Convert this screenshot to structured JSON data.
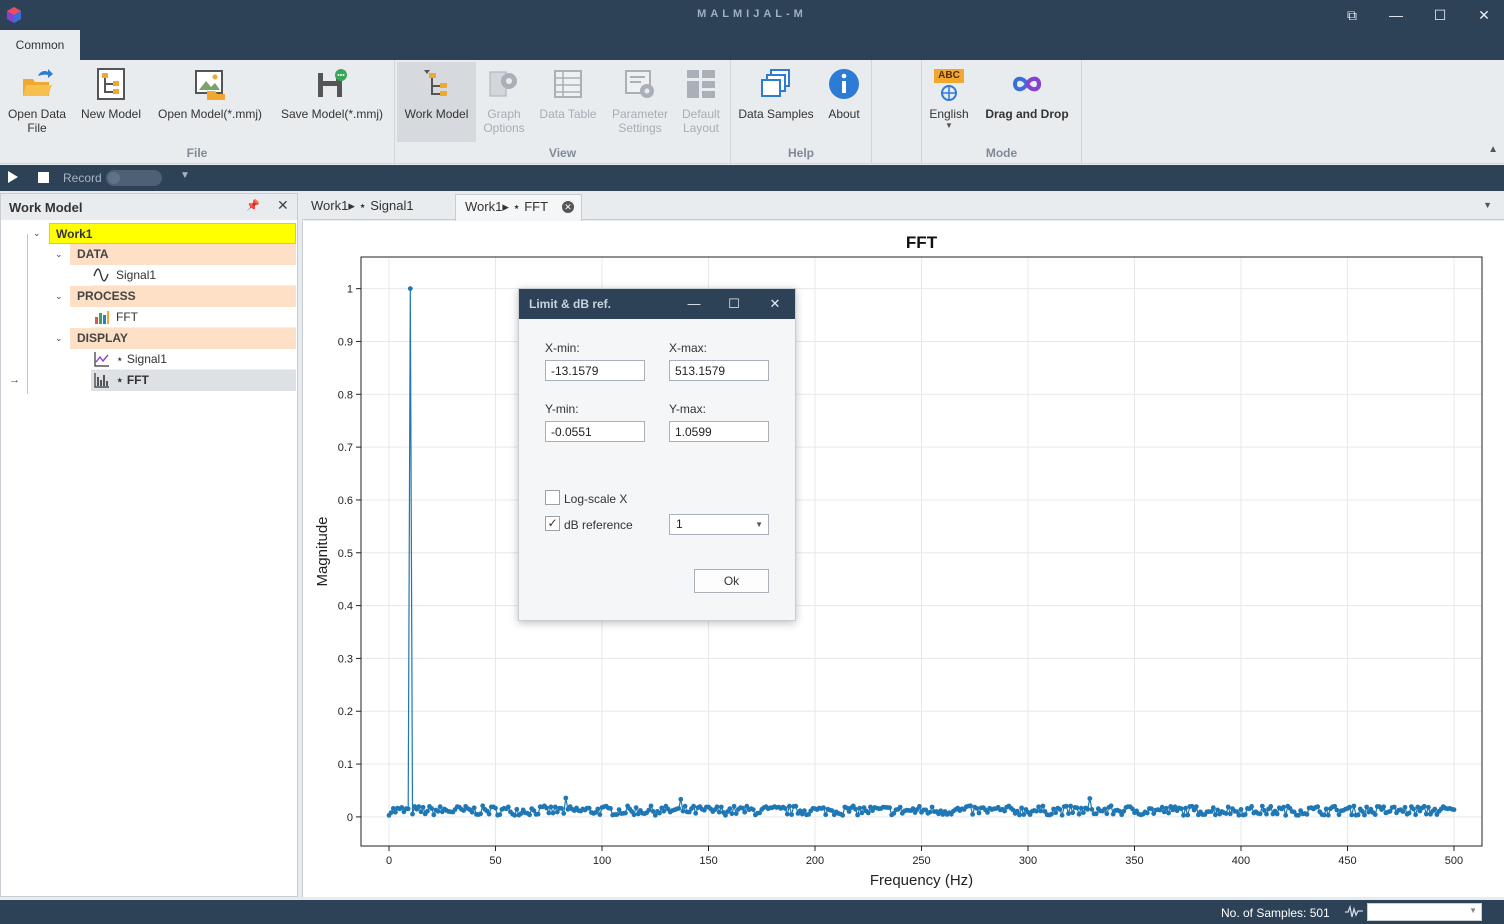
{
  "app": {
    "title": "MALMIJAL-M"
  },
  "window_controls": {
    "restore": "⧉",
    "minimize": "—",
    "maximize": "☐",
    "close": "✕"
  },
  "ribbon": {
    "tab": "Common",
    "groups": {
      "file": "File",
      "view": "View",
      "help": "Help",
      "mode": "Mode"
    },
    "buttons": {
      "open_data_file": "Open Data File",
      "new_model": "New Model",
      "open_model": "Open Model(*.mmj)",
      "save_model": "Save Model(*.mmj)",
      "work_model": "Work Model",
      "graph_options": "Graph Options",
      "data_table": "Data Table",
      "parameter_settings": "Parameter Settings",
      "default_layout": "Default Layout",
      "data_samples": "Data Samples",
      "about": "About",
      "english": "English",
      "drag_and_drop": "Drag and Drop",
      "abc_badge": "ABC"
    }
  },
  "recordbar": {
    "record_label": "Record"
  },
  "left_panel": {
    "title": "Work Model",
    "tree": {
      "root": "Work1",
      "data_group": "DATA",
      "data_item": "Signal1",
      "process_group": "PROCESS",
      "process_item": "FFT",
      "display_group": "DISPLAY",
      "display_item1": "⋆ Signal1",
      "display_item2": "⋆ FFT"
    }
  },
  "doc_tabs": {
    "tab1": "Work1▸ ⋆ Signal1",
    "tab2": "Work1▸ ⋆ FFT"
  },
  "chart_data": {
    "type": "line",
    "title": "FFT",
    "xlabel": "Frequency (Hz)",
    "ylabel": "Magnitude",
    "xlim": [
      -13.1579,
      513.1579
    ],
    "ylim": [
      -0.0551,
      1.0599
    ],
    "xticks": [
      0,
      50,
      100,
      150,
      200,
      250,
      300,
      350,
      400,
      450,
      500
    ],
    "yticks": [
      0,
      0.1,
      0.2,
      0.3,
      0.4,
      0.5,
      0.6,
      0.7,
      0.8,
      0.9,
      1
    ],
    "grid": true,
    "markers": true,
    "color": "#1f77b4",
    "series": [
      {
        "peak": {
          "x": 10,
          "y": 1.0
        },
        "noise_floor_mean": 0.012,
        "noise_floor_max": 0.04,
        "x_start": 0,
        "x_end": 500,
        "x_step": 1
      }
    ]
  },
  "dialog": {
    "title": "Limit & dB ref.",
    "xmin_label": "X-min:",
    "xmax_label": "X-max:",
    "ymin_label": "Y-min:",
    "ymax_label": "Y-max:",
    "xmin": "-13.1579",
    "xmax": "513.1579",
    "ymin": "-0.0551",
    "ymax": "1.0599",
    "logscale_label": "Log-scale X",
    "logscale_checked": false,
    "dbref_label": "dB reference",
    "dbref_checked": true,
    "dbref_value": "1",
    "ok_label": "Ok"
  },
  "statusbar": {
    "samples": "No. of Samples: 501"
  }
}
